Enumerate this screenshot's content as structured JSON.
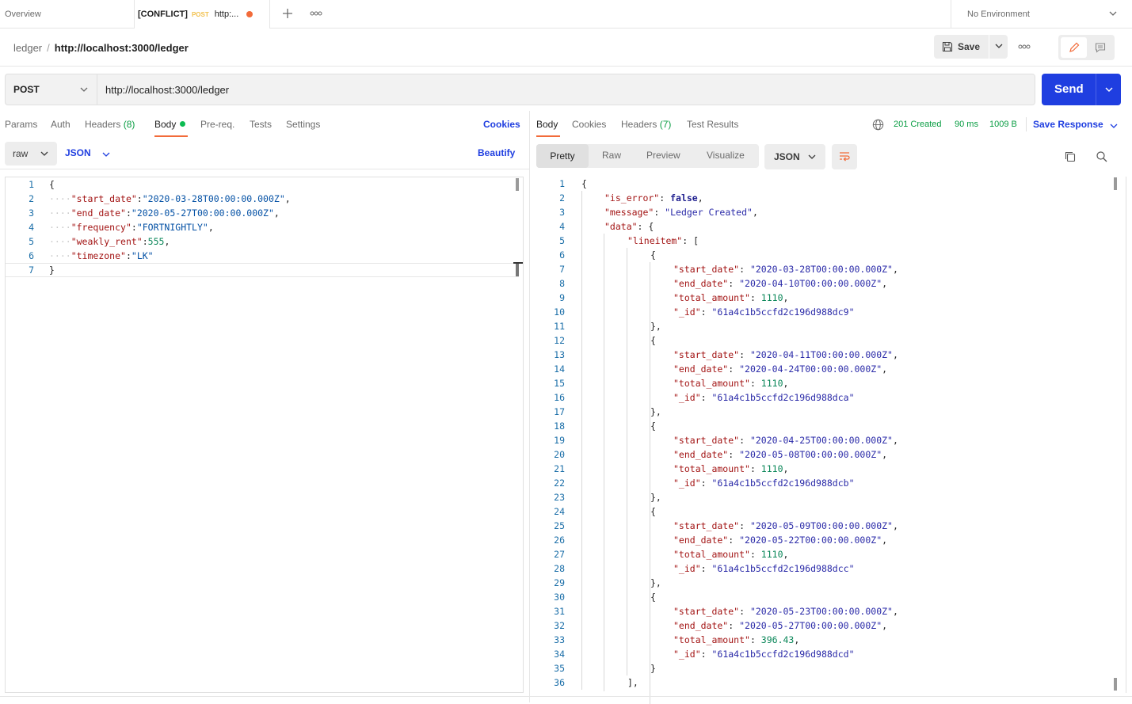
{
  "tabs": {
    "overview": "Overview",
    "active_conflict": "[CONFLICT]",
    "active_method": "POST",
    "active_url": "http:...",
    "environment": "No Environment"
  },
  "breadcrumb": {
    "collection": "ledger",
    "separator": "/",
    "request": "http://localhost:3000/ledger"
  },
  "toolbar": {
    "save_label": "Save"
  },
  "request": {
    "method": "POST",
    "url": "http://localhost:3000/ledger",
    "send_label": "Send",
    "tabs": {
      "params": "Params",
      "auth": "Auth",
      "headers": "Headers",
      "headers_count": "(8)",
      "body": "Body",
      "prereq": "Pre-req.",
      "tests": "Tests",
      "settings": "Settings"
    },
    "cookies_label": "Cookies",
    "body_mode": "raw",
    "body_format": "JSON",
    "beautify_label": "Beautify",
    "body_lines": [
      {
        "num": "1",
        "tokens": [
          [
            "p",
            "{"
          ]
        ]
      },
      {
        "num": "2",
        "tokens": [
          [
            "ws",
            "····"
          ],
          [
            "k",
            "\"start_date\""
          ],
          [
            "p",
            ":"
          ],
          [
            "s",
            "\"2020-03-28T00:00:00.000Z\""
          ],
          [
            "p",
            ","
          ]
        ]
      },
      {
        "num": "3",
        "tokens": [
          [
            "ws",
            "····"
          ],
          [
            "k",
            "\"end_date\""
          ],
          [
            "p",
            ":"
          ],
          [
            "s",
            "\"2020-05-27T00:00:00.000Z\""
          ],
          [
            "p",
            ","
          ]
        ]
      },
      {
        "num": "4",
        "tokens": [
          [
            "ws",
            "····"
          ],
          [
            "k",
            "\"frequency\""
          ],
          [
            "p",
            ":"
          ],
          [
            "s",
            "\"FORTNIGHTLY\""
          ],
          [
            "p",
            ","
          ]
        ]
      },
      {
        "num": "5",
        "tokens": [
          [
            "ws",
            "····"
          ],
          [
            "k",
            "\"weakly_rent\""
          ],
          [
            "p",
            ":"
          ],
          [
            "n",
            "555"
          ],
          [
            "p",
            ","
          ]
        ]
      },
      {
        "num": "6",
        "tokens": [
          [
            "ws",
            "····"
          ],
          [
            "k",
            "\"timezone\""
          ],
          [
            "p",
            ":"
          ],
          [
            "s",
            "\"LK\""
          ]
        ]
      },
      {
        "num": "7",
        "tokens": [
          [
            "p",
            "}"
          ]
        ]
      }
    ]
  },
  "response": {
    "tabs": {
      "body": "Body",
      "cookies": "Cookies",
      "headers": "Headers",
      "headers_count": "(7)",
      "test_results": "Test Results"
    },
    "status": "201 Created",
    "time": "90 ms",
    "size": "1009 B",
    "save_response_label": "Save Response",
    "views": {
      "pretty": "Pretty",
      "raw": "Raw",
      "preview": "Preview",
      "visualize": "Visualize"
    },
    "format": "JSON",
    "body_lines": [
      {
        "num": "1",
        "indent": 0,
        "tokens": [
          [
            "p",
            "{"
          ]
        ]
      },
      {
        "num": "2",
        "indent": 1,
        "tokens": [
          [
            "k",
            "\"is_error\""
          ],
          [
            "p",
            ": "
          ],
          [
            "b",
            "false"
          ],
          [
            "p",
            ","
          ]
        ]
      },
      {
        "num": "3",
        "indent": 1,
        "tokens": [
          [
            "k",
            "\"message\""
          ],
          [
            "p",
            ": "
          ],
          [
            "rs",
            "\"Ledger Created\""
          ],
          [
            "p",
            ","
          ]
        ]
      },
      {
        "num": "4",
        "indent": 1,
        "tokens": [
          [
            "k",
            "\"data\""
          ],
          [
            "p",
            ": {"
          ]
        ]
      },
      {
        "num": "5",
        "indent": 2,
        "tokens": [
          [
            "k",
            "\"lineitem\""
          ],
          [
            "p",
            ": ["
          ]
        ]
      },
      {
        "num": "6",
        "indent": 3,
        "tokens": [
          [
            "p",
            "{"
          ]
        ]
      },
      {
        "num": "7",
        "indent": 4,
        "tokens": [
          [
            "k",
            "\"start_date\""
          ],
          [
            "p",
            ": "
          ],
          [
            "rs",
            "\"2020-03-28T00:00:00.000Z\""
          ],
          [
            "p",
            ","
          ]
        ]
      },
      {
        "num": "8",
        "indent": 4,
        "tokens": [
          [
            "k",
            "\"end_date\""
          ],
          [
            "p",
            ": "
          ],
          [
            "rs",
            "\"2020-04-10T00:00:00.000Z\""
          ],
          [
            "p",
            ","
          ]
        ]
      },
      {
        "num": "9",
        "indent": 4,
        "tokens": [
          [
            "k",
            "\"total_amount\""
          ],
          [
            "p",
            ": "
          ],
          [
            "n",
            "1110"
          ],
          [
            "p",
            ","
          ]
        ]
      },
      {
        "num": "10",
        "indent": 4,
        "tokens": [
          [
            "k",
            "\"_id\""
          ],
          [
            "p",
            ": "
          ],
          [
            "rs",
            "\"61a4c1b5ccfd2c196d988dc9\""
          ]
        ]
      },
      {
        "num": "11",
        "indent": 3,
        "tokens": [
          [
            "p",
            "},"
          ]
        ]
      },
      {
        "num": "12",
        "indent": 3,
        "tokens": [
          [
            "p",
            "{"
          ]
        ]
      },
      {
        "num": "13",
        "indent": 4,
        "tokens": [
          [
            "k",
            "\"start_date\""
          ],
          [
            "p",
            ": "
          ],
          [
            "rs",
            "\"2020-04-11T00:00:00.000Z\""
          ],
          [
            "p",
            ","
          ]
        ]
      },
      {
        "num": "14",
        "indent": 4,
        "tokens": [
          [
            "k",
            "\"end_date\""
          ],
          [
            "p",
            ": "
          ],
          [
            "rs",
            "\"2020-04-24T00:00:00.000Z\""
          ],
          [
            "p",
            ","
          ]
        ]
      },
      {
        "num": "15",
        "indent": 4,
        "tokens": [
          [
            "k",
            "\"total_amount\""
          ],
          [
            "p",
            ": "
          ],
          [
            "n",
            "1110"
          ],
          [
            "p",
            ","
          ]
        ]
      },
      {
        "num": "16",
        "indent": 4,
        "tokens": [
          [
            "k",
            "\"_id\""
          ],
          [
            "p",
            ": "
          ],
          [
            "rs",
            "\"61a4c1b5ccfd2c196d988dca\""
          ]
        ]
      },
      {
        "num": "17",
        "indent": 3,
        "tokens": [
          [
            "p",
            "},"
          ]
        ]
      },
      {
        "num": "18",
        "indent": 3,
        "tokens": [
          [
            "p",
            "{"
          ]
        ]
      },
      {
        "num": "19",
        "indent": 4,
        "tokens": [
          [
            "k",
            "\"start_date\""
          ],
          [
            "p",
            ": "
          ],
          [
            "rs",
            "\"2020-04-25T00:00:00.000Z\""
          ],
          [
            "p",
            ","
          ]
        ]
      },
      {
        "num": "20",
        "indent": 4,
        "tokens": [
          [
            "k",
            "\"end_date\""
          ],
          [
            "p",
            ": "
          ],
          [
            "rs",
            "\"2020-05-08T00:00:00.000Z\""
          ],
          [
            "p",
            ","
          ]
        ]
      },
      {
        "num": "21",
        "indent": 4,
        "tokens": [
          [
            "k",
            "\"total_amount\""
          ],
          [
            "p",
            ": "
          ],
          [
            "n",
            "1110"
          ],
          [
            "p",
            ","
          ]
        ]
      },
      {
        "num": "22",
        "indent": 4,
        "tokens": [
          [
            "k",
            "\"_id\""
          ],
          [
            "p",
            ": "
          ],
          [
            "rs",
            "\"61a4c1b5ccfd2c196d988dcb\""
          ]
        ]
      },
      {
        "num": "23",
        "indent": 3,
        "tokens": [
          [
            "p",
            "},"
          ]
        ]
      },
      {
        "num": "24",
        "indent": 3,
        "tokens": [
          [
            "p",
            "{"
          ]
        ]
      },
      {
        "num": "25",
        "indent": 4,
        "tokens": [
          [
            "k",
            "\"start_date\""
          ],
          [
            "p",
            ": "
          ],
          [
            "rs",
            "\"2020-05-09T00:00:00.000Z\""
          ],
          [
            "p",
            ","
          ]
        ]
      },
      {
        "num": "26",
        "indent": 4,
        "tokens": [
          [
            "k",
            "\"end_date\""
          ],
          [
            "p",
            ": "
          ],
          [
            "rs",
            "\"2020-05-22T00:00:00.000Z\""
          ],
          [
            "p",
            ","
          ]
        ]
      },
      {
        "num": "27",
        "indent": 4,
        "tokens": [
          [
            "k",
            "\"total_amount\""
          ],
          [
            "p",
            ": "
          ],
          [
            "n",
            "1110"
          ],
          [
            "p",
            ","
          ]
        ]
      },
      {
        "num": "28",
        "indent": 4,
        "tokens": [
          [
            "k",
            "\"_id\""
          ],
          [
            "p",
            ": "
          ],
          [
            "rs",
            "\"61a4c1b5ccfd2c196d988dcc\""
          ]
        ]
      },
      {
        "num": "29",
        "indent": 3,
        "tokens": [
          [
            "p",
            "},"
          ]
        ]
      },
      {
        "num": "30",
        "indent": 3,
        "tokens": [
          [
            "p",
            "{"
          ]
        ]
      },
      {
        "num": "31",
        "indent": 4,
        "tokens": [
          [
            "k",
            "\"start_date\""
          ],
          [
            "p",
            ": "
          ],
          [
            "rs",
            "\"2020-05-23T00:00:00.000Z\""
          ],
          [
            "p",
            ","
          ]
        ]
      },
      {
        "num": "32",
        "indent": 4,
        "tokens": [
          [
            "k",
            "\"end_date\""
          ],
          [
            "p",
            ": "
          ],
          [
            "rs",
            "\"2020-05-27T00:00:00.000Z\""
          ],
          [
            "p",
            ","
          ]
        ]
      },
      {
        "num": "33",
        "indent": 4,
        "tokens": [
          [
            "k",
            "\"total_amount\""
          ],
          [
            "p",
            ": "
          ],
          [
            "n",
            "396.43"
          ],
          [
            "p",
            ","
          ]
        ]
      },
      {
        "num": "34",
        "indent": 4,
        "tokens": [
          [
            "k",
            "\"_id\""
          ],
          [
            "p",
            ": "
          ],
          [
            "rs",
            "\"61a4c1b5ccfd2c196d988dcd\""
          ]
        ]
      },
      {
        "num": "35",
        "indent": 3,
        "tokens": [
          [
            "p",
            "}"
          ]
        ]
      },
      {
        "num": "36",
        "indent": 2,
        "tokens": [
          [
            "p",
            "],"
          ]
        ]
      }
    ]
  },
  "colors": {
    "accent": "#f26b3a",
    "primary": "#1f3ee0",
    "success": "#0a9d43"
  }
}
